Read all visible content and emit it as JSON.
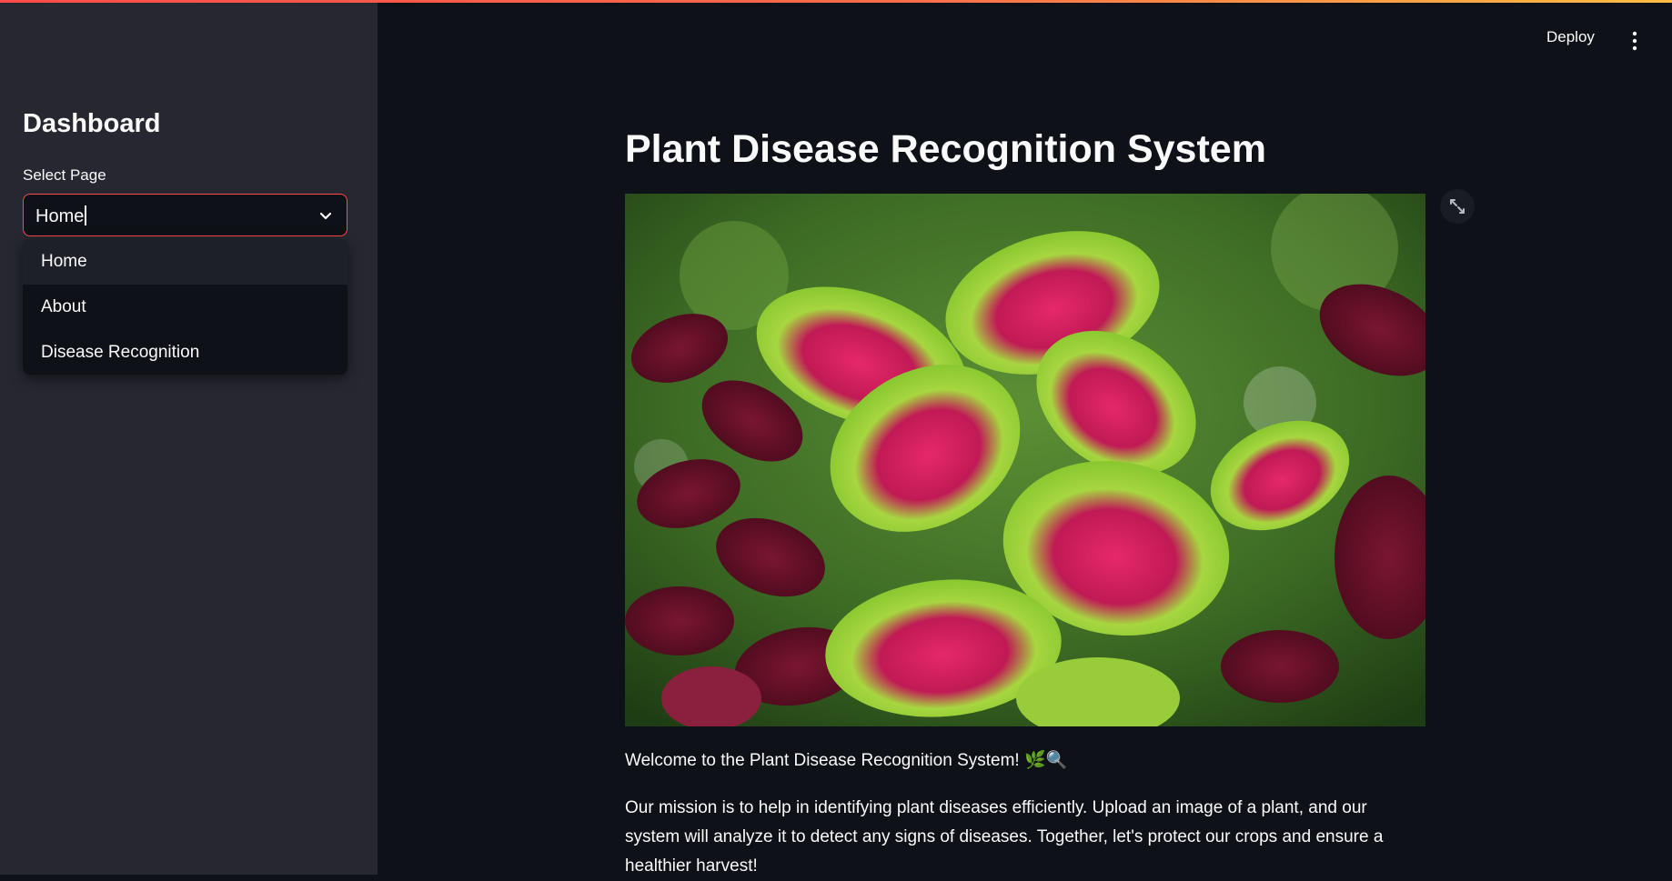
{
  "colors": {
    "accent": "#ff4b4b",
    "background": "#0e1117",
    "sidebar": "#262730",
    "text": "#fafafa"
  },
  "sidebar": {
    "title": "Dashboard",
    "select_label": "Select Page",
    "select_value": "Home",
    "options": [
      {
        "label": "Home",
        "active": true
      },
      {
        "label": "About",
        "active": false
      },
      {
        "label": "Disease Recognition",
        "active": false
      }
    ]
  },
  "header": {
    "deploy_label": "Deploy",
    "menu_icon": "vertical-dots-icon"
  },
  "main": {
    "title": "Plant Disease Recognition System",
    "image_icon": "expand-icon",
    "welcome": "Welcome to the Plant Disease Recognition System! 🌿🔍",
    "mission": "Our mission is to help in identifying plant diseases efficiently. Upload an image of a plant, and our system will analyze it to detect any signs of diseases. Together, let's protect our crops and ensure a healthier harvest!"
  }
}
